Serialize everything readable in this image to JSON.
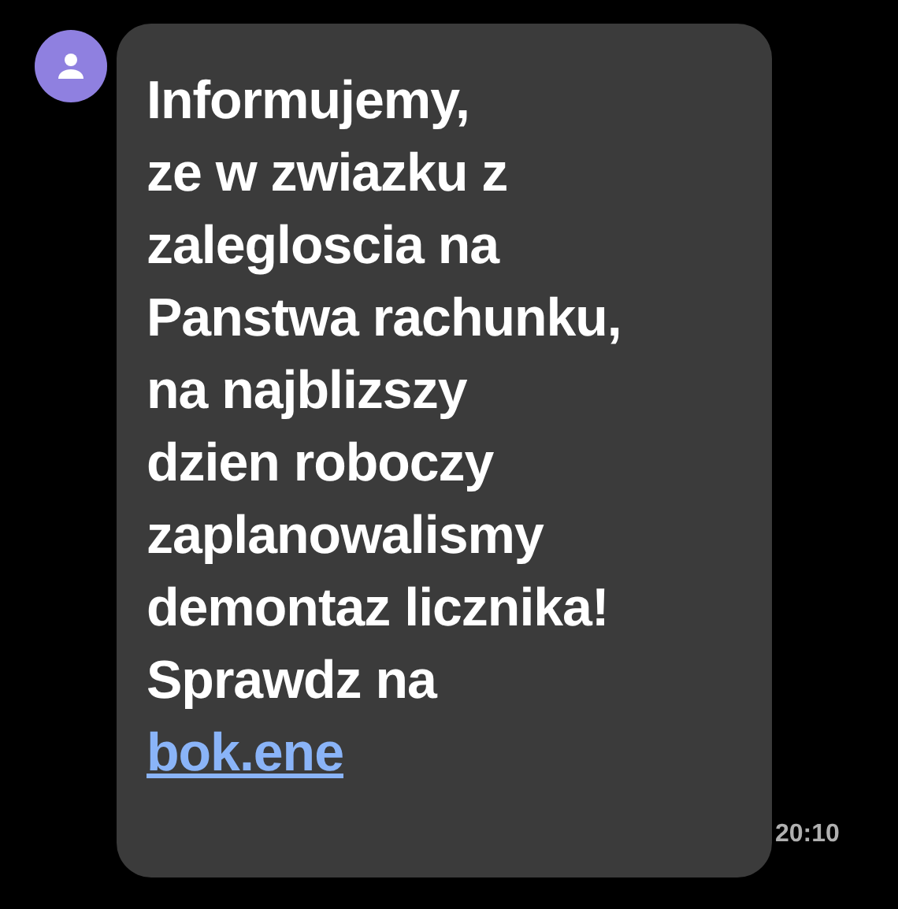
{
  "message": {
    "lines": [
      "Informujemy,",
      "ze w zwiazku z",
      "zalegloscia na",
      "Panstwa rachunku,",
      "na najblizszy",
      "dzien roboczy",
      "zaplanowalismy",
      "demontaz licznika!",
      "Sprawdz na"
    ],
    "link": "bok.ene",
    "time": "20:10"
  }
}
